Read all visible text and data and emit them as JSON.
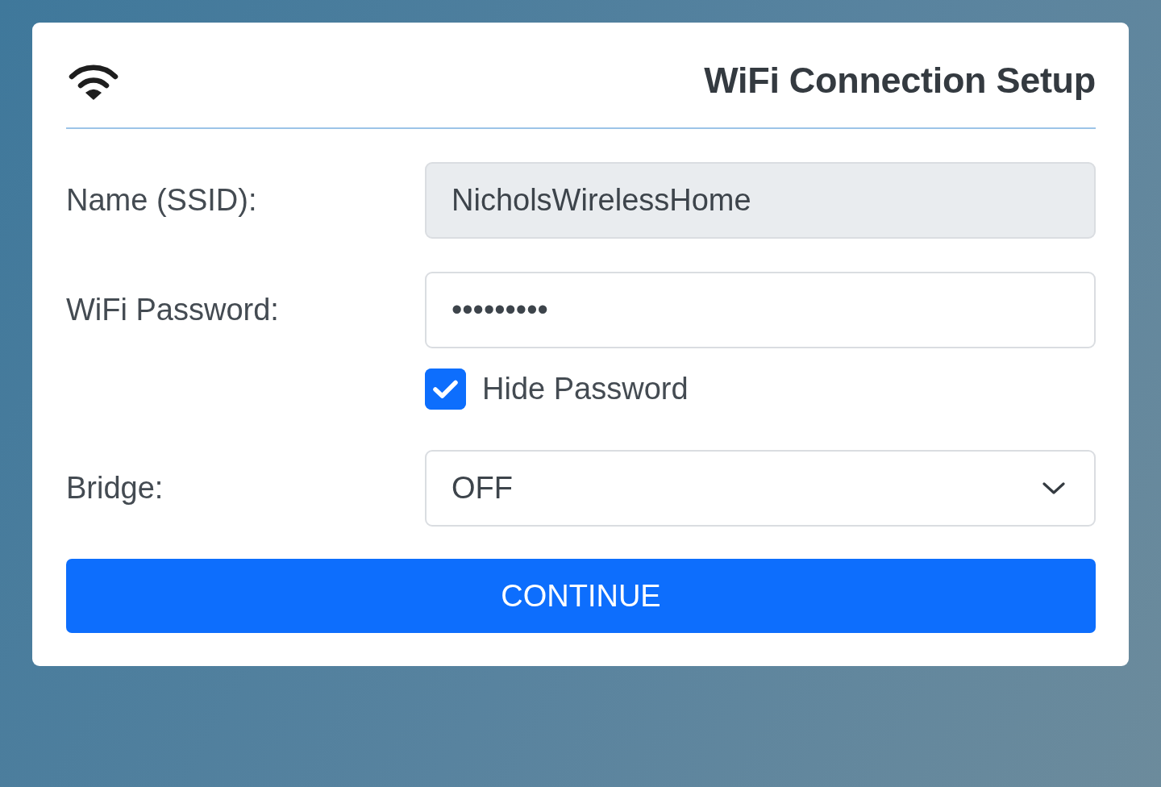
{
  "header": {
    "title": "WiFi Connection Setup"
  },
  "fields": [
    {
      "kind": "text",
      "label": "Name (SSID):",
      "value": "NicholsWirelessHome",
      "disabled": true
    },
    {
      "kind": "text",
      "label": "WiFi Password:",
      "value": "•••••••••",
      "disabled": false
    },
    {
      "kind": "checkbox",
      "label": "Hide Password",
      "checked": true
    },
    {
      "kind": "select",
      "label": "Bridge:",
      "value": "OFF",
      "disabled": false
    }
  ],
  "button": {
    "label": "CONTINUE"
  }
}
